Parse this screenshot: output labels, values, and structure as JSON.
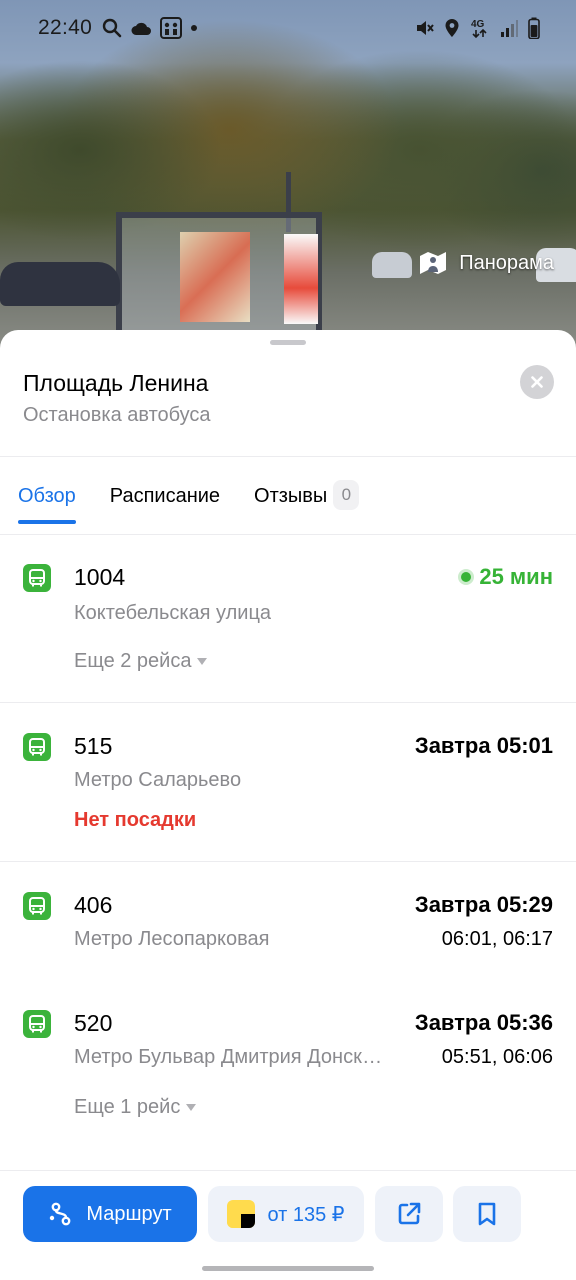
{
  "status_bar": {
    "time": "22:40",
    "left_icons": [
      "search-icon",
      "cloud-icon",
      "app-notification-icon",
      "dot-icon"
    ],
    "right_icons": [
      "mute-icon",
      "location-icon",
      "network-4g-icon",
      "signal-icon",
      "battery-icon"
    ],
    "network": "4G"
  },
  "photo": {
    "panorama_label": "Панорама",
    "panorama_icon": "panorama-icon"
  },
  "stop": {
    "title": "Площадь Ленина",
    "subtitle": "Остановка автобуса"
  },
  "tabs": [
    {
      "label": "Обзор",
      "active": true
    },
    {
      "label": "Расписание",
      "active": false
    },
    {
      "label": "Отзывы",
      "active": false,
      "badge": "0"
    }
  ],
  "routes": [
    {
      "number": "1004",
      "destination": "Коктебельская улица",
      "time": "25 мин",
      "live": true,
      "more": "Еще 2 рейса"
    },
    {
      "number": "515",
      "destination": "Метро Саларьево",
      "time": "Завтра 05:01",
      "warning": "Нет посадки"
    },
    {
      "number": "406",
      "destination": "Метро Лесопарковая",
      "time": "Завтра 05:29",
      "next": "06:01, 06:17"
    },
    {
      "number": "520",
      "destination": "Метро Бульвар Дмитрия Донского",
      "time": "Завтра 05:36",
      "next": "05:51, 06:06",
      "more": "Еще 1 рейс"
    }
  ],
  "actions": {
    "route_label": "Маршрут",
    "taxi_label": "от 135 ₽"
  },
  "colors": {
    "accent": "#1a73e8",
    "bus_green": "#3bb33b",
    "live_green": "#36b336",
    "warning_red": "#e5392f",
    "secondary_text": "#8a8a8e"
  }
}
